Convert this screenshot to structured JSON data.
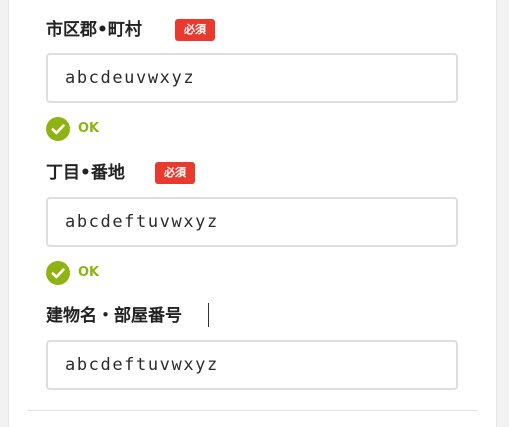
{
  "fields": [
    {
      "label": "市区郡•町村",
      "required_badge": "必須",
      "value": "abcdeuvwxyz",
      "status_text": "OK"
    },
    {
      "label": "丁目•番地",
      "required_badge": "必須",
      "value": "abcdeftuvwxyz",
      "status_text": "OK"
    },
    {
      "label": "建物名・部屋番号",
      "value": "abcdeftuvwxyz"
    }
  ],
  "colors": {
    "badge_bg": "#ea3a2e",
    "ok_green": "#8fb312",
    "input_border": "#dedede"
  },
  "icons": {
    "status": "check-circle-icon"
  }
}
